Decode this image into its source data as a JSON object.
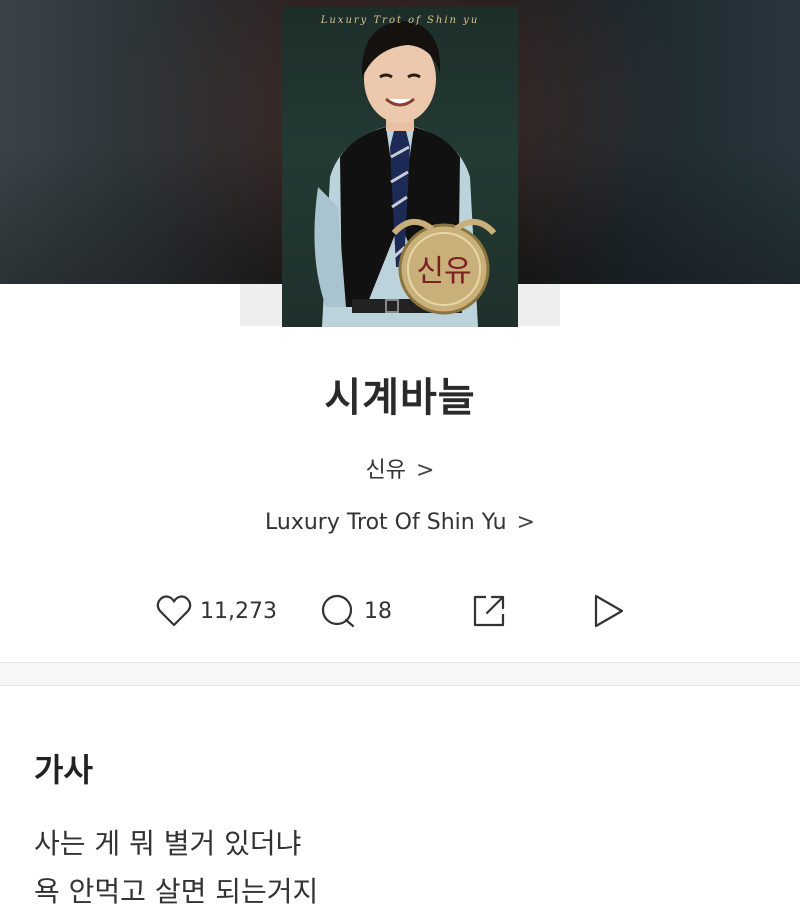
{
  "song": {
    "title": "시계바늘",
    "artist": "신유",
    "album": "Luxury Trot Of Shin Yu",
    "chevron": ">"
  },
  "cover": {
    "title_text": "Luxury Trot of Shin yu",
    "medal_text": "신유"
  },
  "actions": {
    "likes": "11,273",
    "comments": "18",
    "icons": [
      "heart-icon",
      "comment-icon",
      "share-icon",
      "play-icon"
    ]
  },
  "lyrics": {
    "heading": "가사",
    "lines": [
      "사는 게 뭐 별거 있더냐",
      "욕 안먹고 살면 되는거지"
    ]
  },
  "colors": {
    "background": "#ffffff",
    "text": "#222222",
    "divider": "#e6e6e6"
  }
}
